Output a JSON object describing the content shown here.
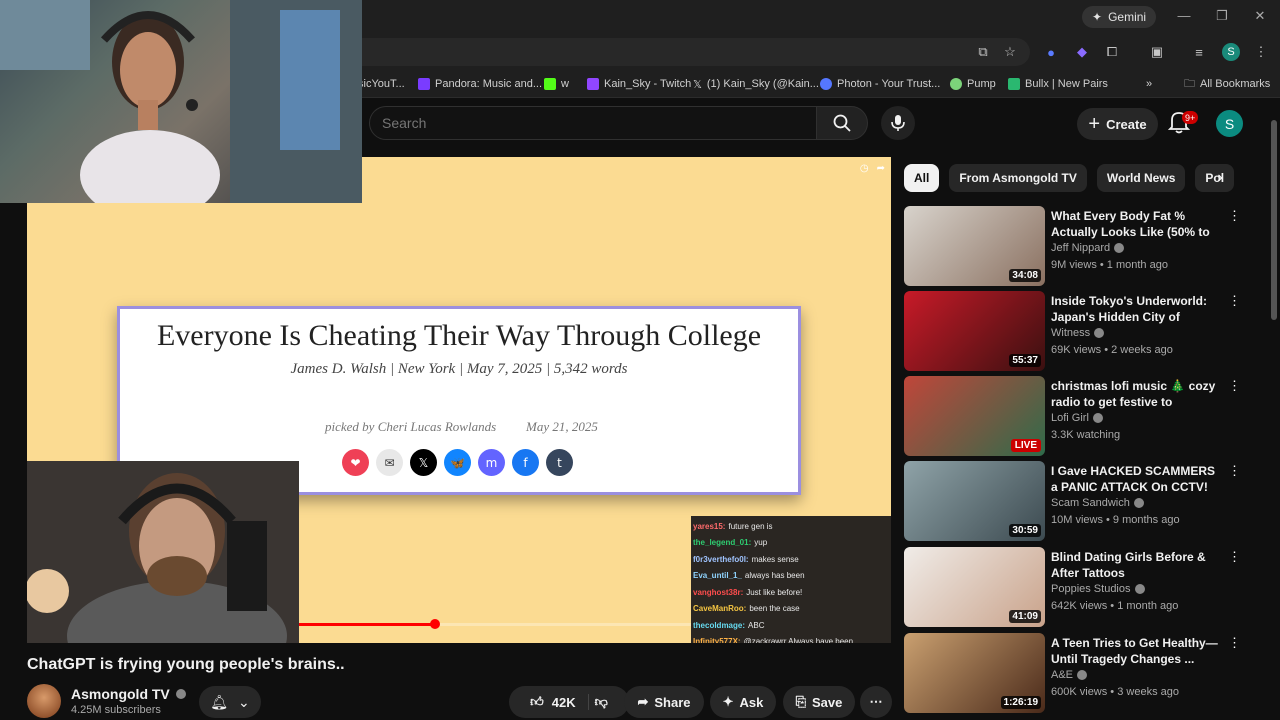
{
  "browser": {
    "gemini_label": "Gemini",
    "bookmarks": [
      {
        "label": "sicYouT...",
        "color": "#c00"
      },
      {
        "label": "Pandora: Music and...",
        "color": "#7a3cff"
      },
      {
        "label": "w",
        "color": "#53fc18"
      },
      {
        "label": "Kain_Sky - Twitch",
        "color": "#9146ff"
      },
      {
        "label": "(1) Kain_Sky (@Kain...",
        "color": "#000"
      },
      {
        "label": "Photon - Your Trust...",
        "color": "#5577ff"
      },
      {
        "label": "Pump",
        "color": "#7cd37a"
      },
      {
        "label": "Bullx | New Pairs",
        "color": "#2ab870"
      }
    ],
    "all_bookmarks": "All Bookmarks",
    "profile_initial": "S"
  },
  "header": {
    "search_placeholder": "Search",
    "create_label": "Create",
    "notifications_badge": "9+",
    "avatar_initial": "S"
  },
  "article": {
    "title": "Everyone Is Cheating Their Way Through College",
    "byline": "James D. Walsh  |  New York  |  May 7, 2025  |  5,342 words",
    "picked": "picked by Cheri Lucas Rowlands",
    "picked_date": "May 21, 2025",
    "share_icons": [
      {
        "name": "pocket-icon",
        "glyph": "❤",
        "color": "#ef4056"
      },
      {
        "name": "email-icon",
        "glyph": "✉",
        "color": "#e8e8e8"
      },
      {
        "name": "x-icon",
        "glyph": "𝕏",
        "color": "#000000"
      },
      {
        "name": "bluesky-icon",
        "glyph": "🦋",
        "color": "#1185fe"
      },
      {
        "name": "mastodon-icon",
        "glyph": "m",
        "color": "#6364ff"
      },
      {
        "name": "facebook-icon",
        "glyph": "f",
        "color": "#1877f2"
      },
      {
        "name": "tumblr-icon",
        "glyph": "t",
        "color": "#36465d"
      }
    ]
  },
  "chat": [
    {
      "name": "yares15:",
      "msg": "future gen is",
      "color": "#ff6b6b"
    },
    {
      "name": "the_legend_01:",
      "msg": "yup",
      "color": "#2ecc71"
    },
    {
      "name": "f0r3verthefo0l:",
      "msg": "makes sense",
      "color": "#a0c4ff"
    },
    {
      "name": "Eva_until_1_",
      "msg": "always has been",
      "color": "#8fd3fe"
    },
    {
      "name": "vanghost38r:",
      "msg": "Just like before!",
      "color": "#ff4d4d"
    },
    {
      "name": "CaveManRoo:",
      "msg": "been the case",
      "color": "#f5c542"
    },
    {
      "name": "thecoldmage:",
      "msg": "ABC",
      "color": "#66d9ef"
    },
    {
      "name": "Infinity577X:",
      "msg": "@zackrawrr Always have been",
      "color": "#ffb347"
    }
  ],
  "progress": {
    "played_fraction": 0.35
  },
  "video": {
    "title": "ChatGPT is frying young people's brains..",
    "channel": "Asmongold TV",
    "subscribers": "4.25M subscribers",
    "likes": "42K",
    "share_label": "Share",
    "ask_label": "Ask",
    "save_label": "Save"
  },
  "chips": [
    "All",
    "From Asmongold TV",
    "World News",
    "Pol"
  ],
  "recommendations": [
    {
      "title": "What Every Body Fat % Actually Looks Like (50% to 5%)",
      "channel": "Jeff Nippard",
      "meta": "9M views • 1 month ago",
      "duration": "34:08",
      "live": false,
      "thumb_colors": [
        "#d8d3cc",
        "#8a7060"
      ]
    },
    {
      "title": "Inside Tokyo's Underworld: Japan's Hidden City of Women...",
      "channel": "Witness",
      "meta": "69K views • 2 weeks ago",
      "duration": "55:37",
      "live": false,
      "thumb_colors": [
        "#c81a28",
        "#3a1010"
      ]
    },
    {
      "title": "christmas lofi music 🎄 cozy radio to get festive to",
      "channel": "Lofi Girl",
      "meta": "3.3K watching",
      "duration": "LIVE",
      "live": true,
      "thumb_colors": [
        "#c0463a",
        "#2f6b4a"
      ]
    },
    {
      "title": "I Gave HACKED SCAMMERS a PANIC ATTACK On CCTV!",
      "channel": "Scam Sandwich",
      "meta": "10M views • 9 months ago",
      "duration": "30:59",
      "live": false,
      "thumb_colors": [
        "#8fa3a8",
        "#3c4a50"
      ]
    },
    {
      "title": "Blind Dating Girls Before & After Tattoos",
      "channel": "Poppies Studios",
      "meta": "642K views • 1 month ago",
      "duration": "41:09",
      "live": false,
      "thumb_colors": [
        "#f0ece8",
        "#c9a28a"
      ]
    },
    {
      "title": "A Teen Tries to Get Healthy— Until Tragedy Changes ...",
      "channel": "A&E",
      "meta": "600K views • 3 weeks ago",
      "duration": "1:26:19",
      "live": false,
      "thumb_colors": [
        "#caa070",
        "#4a2a1a"
      ]
    }
  ]
}
